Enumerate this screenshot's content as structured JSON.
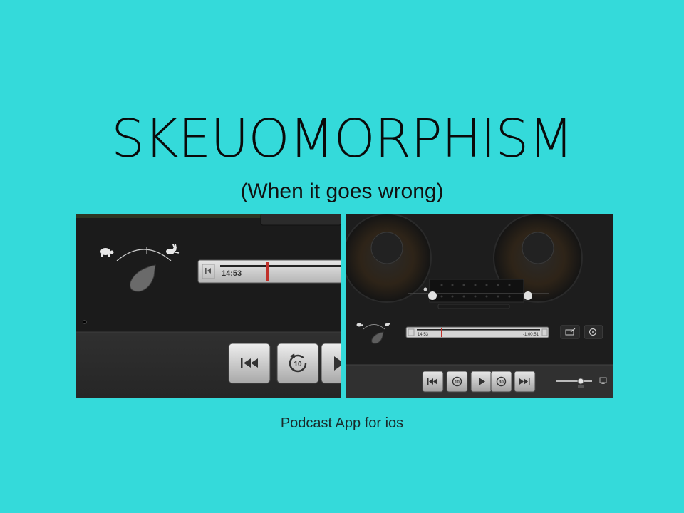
{
  "slide": {
    "title": "SKEUOMORPHISM",
    "subtitle": "(When it goes wrong)",
    "caption": "Podcast App for ios"
  },
  "left_shot": {
    "time_elapsed": "14:53",
    "rewind_label": "10",
    "icons": [
      "tortoise-icon",
      "hare-icon",
      "speed-knob-icon",
      "skip-back-icon",
      "rewind-10-icon",
      "play-icon"
    ]
  },
  "right_shot": {
    "time_elapsed": "14:53",
    "time_remaining": "-1:00:51",
    "rewind_label": "10",
    "forward_label": "30",
    "icons": [
      "reel-left-icon",
      "reel-right-icon",
      "tortoise-icon",
      "hare-icon",
      "speed-knob-icon",
      "share-icon",
      "timer-icon",
      "skip-back-icon",
      "rewind-10-icon",
      "play-icon",
      "forward-30-icon",
      "skip-forward-icon",
      "volume-slider",
      "airplay-icon"
    ]
  },
  "colors": {
    "background": "#34dada",
    "progress_marker": "#c0302a"
  }
}
